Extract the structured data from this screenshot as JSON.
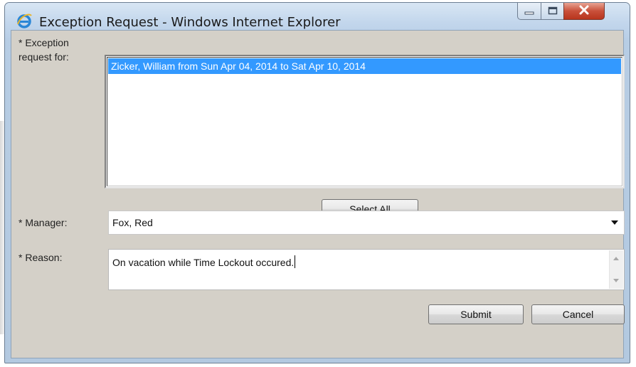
{
  "window": {
    "title": "Exception Request - Windows Internet Explorer",
    "icon": "internet-explorer-icon",
    "controls": [
      "minimize-icon",
      "maximize-icon",
      "close-icon"
    ]
  },
  "form": {
    "exception_label_line1": "* Exception",
    "exception_label_line2": "request for:",
    "exception_items": [
      {
        "text": "Zicker, William from Sun Apr 04, 2014 to Sat Apr 10, 2014",
        "selected": true
      }
    ],
    "select_all_label": "Select All",
    "manager_label": "* Manager:",
    "manager_value": "Fox, Red",
    "reason_label": "* Reason:",
    "reason_value": "On vacation while Time Lockout occured.",
    "submit_label": "Submit",
    "cancel_label": "Cancel"
  },
  "colors": {
    "selection": "#3399ff",
    "dialog_bg": "#d4d0c8",
    "close_button": "#c9503a"
  }
}
